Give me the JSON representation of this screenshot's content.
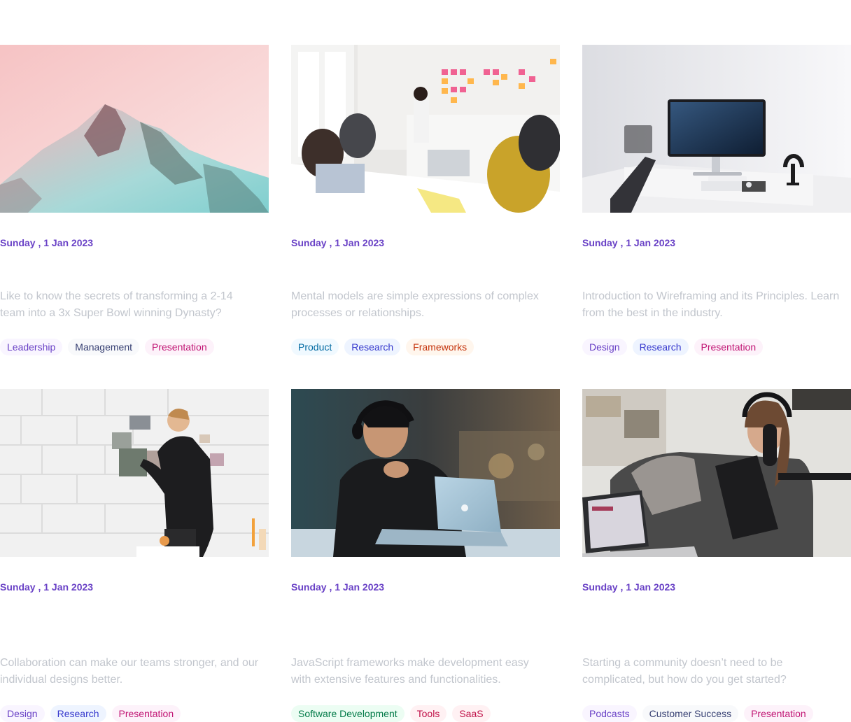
{
  "posts": [
    {
      "date": "Sunday , 1 Jan 2023",
      "description": "Like to know the secrets of transforming a 2-14 team into a 3x Super Bowl winning Dynasty?",
      "tags": [
        "Leadership",
        "Management",
        "Presentation"
      ],
      "image": "snowy-mountain-photo"
    },
    {
      "date": "Sunday , 1 Jan 2023",
      "description": "Mental models are simple expressions of complex processes or relationships.",
      "tags": [
        "Product",
        "Research",
        "Frameworks"
      ],
      "image": "team-meeting-sticky-notes-photo"
    },
    {
      "date": "Sunday , 1 Jan 2023",
      "description": "Introduction to Wireframing and its Principles. Learn from the best in the industry.",
      "tags": [
        "Design",
        "Research",
        "Presentation"
      ],
      "image": "desk-monitor-photo"
    },
    {
      "date": "Sunday , 1 Jan 2023",
      "description": "Collaboration can make our teams stronger, and our individual designs better.",
      "tags": [
        "Design",
        "Research",
        "Presentation"
      ],
      "image": "man-pinning-photos-photo"
    },
    {
      "date": "Sunday , 1 Jan 2023",
      "description": "JavaScript frameworks make development easy with extensive features and functionalities.",
      "tags": [
        "Software Development",
        "Tools",
        "SaaS"
      ],
      "image": "man-with-laptop-photo"
    },
    {
      "date": "Sunday , 1 Jan 2023",
      "description": "Starting a community doesn’t need to be complicated, but how do you get started?",
      "tags": [
        "Podcasts",
        "Customer Success",
        "Presentation"
      ],
      "image": "woman-podcasting-photo"
    }
  ],
  "colors": {
    "date_accent": "#6941c6",
    "description": "#c2c6cd"
  }
}
